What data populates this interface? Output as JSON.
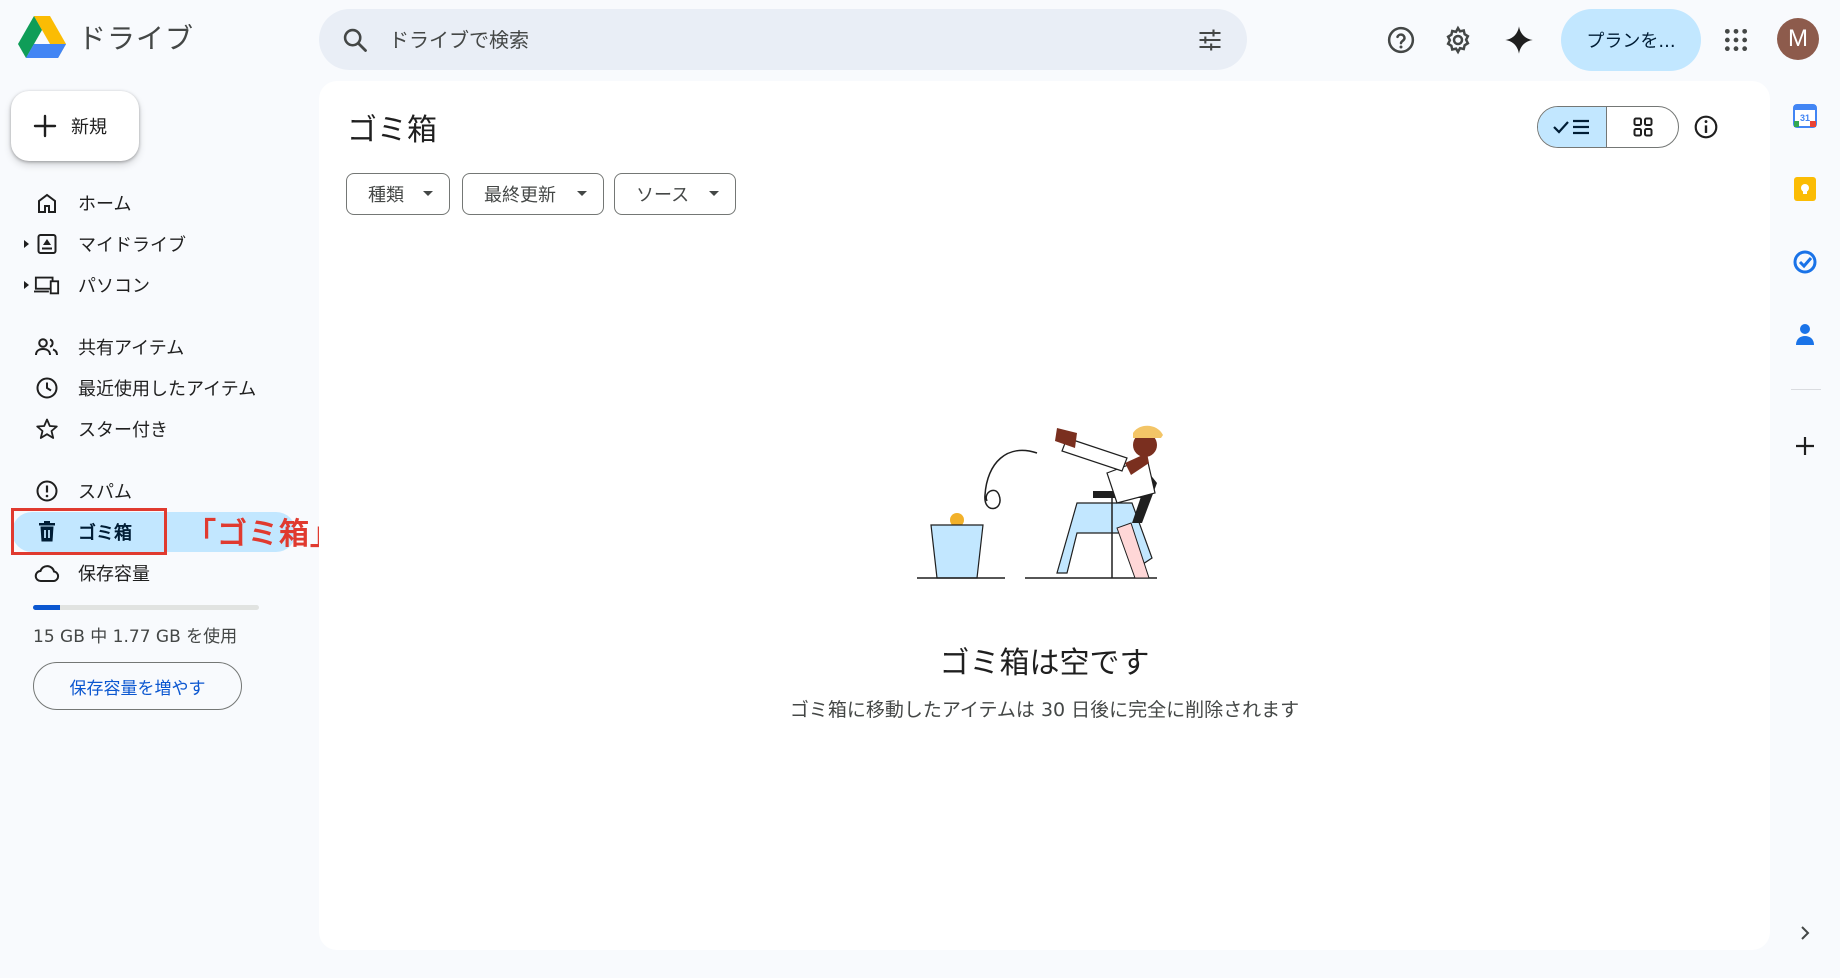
{
  "app": {
    "title": "ドライブ"
  },
  "search": {
    "placeholder": "ドライブで検索"
  },
  "header": {
    "plan_label": "プランを...",
    "avatar_letter": "M"
  },
  "sidebar": {
    "new_label": "新規",
    "items": [
      {
        "label": "ホーム"
      },
      {
        "label": "マイドライブ"
      },
      {
        "label": "パソコン"
      },
      {
        "label": "共有アイテム"
      },
      {
        "label": "最近使用したアイテム"
      },
      {
        "label": "スター付き"
      },
      {
        "label": "スパム"
      },
      {
        "label": "ゴミ箱"
      },
      {
        "label": "保存容量"
      }
    ],
    "storage": {
      "used_fraction": 0.118,
      "text": "15 GB 中 1.77 GB を使用",
      "button_label": "保存容量を増やす"
    }
  },
  "annotation": {
    "text": "「ゴミ箱」をクリック",
    "color": "#e03a2f"
  },
  "main": {
    "title": "ゴミ箱",
    "filters": [
      {
        "label": "種類"
      },
      {
        "label": "最終更新"
      },
      {
        "label": "ソース"
      }
    ],
    "empty_title": "ゴミ箱は空です",
    "empty_desc": "ゴミ箱に移動したアイテムは 30 日後に完全に削除されます"
  },
  "icons": [
    "search-icon",
    "tune-icon",
    "help-icon",
    "settings-icon",
    "gemini-icon",
    "apps-icon",
    "calendar-icon",
    "keep-icon",
    "tasks-icon",
    "contacts-icon",
    "add-icon",
    "chevron-right-icon"
  ],
  "colors": {
    "accent": "#0b57d0",
    "selected": "#c2e7ff",
    "background": "#f8fafd"
  }
}
